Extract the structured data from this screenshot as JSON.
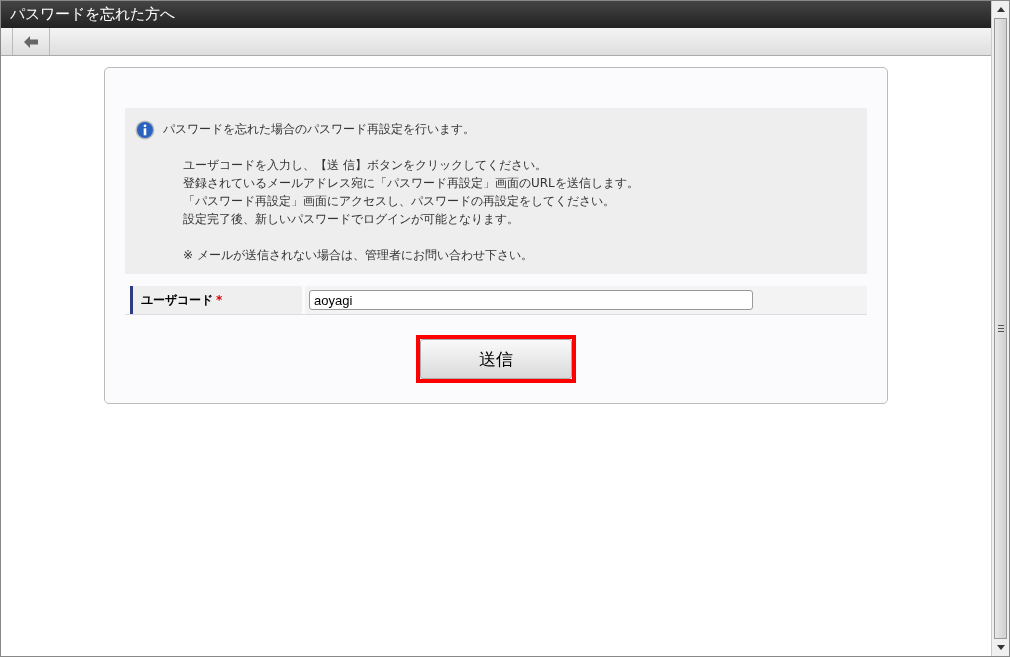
{
  "window": {
    "title": "パスワードを忘れた方へ"
  },
  "info": {
    "paragraphs": [
      [
        "パスワードを忘れた場合のパスワード再設定を行います。"
      ],
      [
        "ユーザコードを入力し、【送 信】ボタンをクリックしてください。",
        "登録されているメールアドレス宛に「パスワード再設定」画面のURLを送信します。",
        "「パスワード再設定」画面にアクセスし、パスワードの再設定をしてください。",
        "設定完了後、新しいパスワードでログインが可能となります。"
      ],
      [
        "※ メールが送信されない場合は、管理者にお問い合わせ下さい。"
      ]
    ]
  },
  "form": {
    "label": "ユーザコード",
    "required_mark": "*",
    "value": "aoyagi"
  },
  "submit_button": {
    "label": "送信"
  }
}
